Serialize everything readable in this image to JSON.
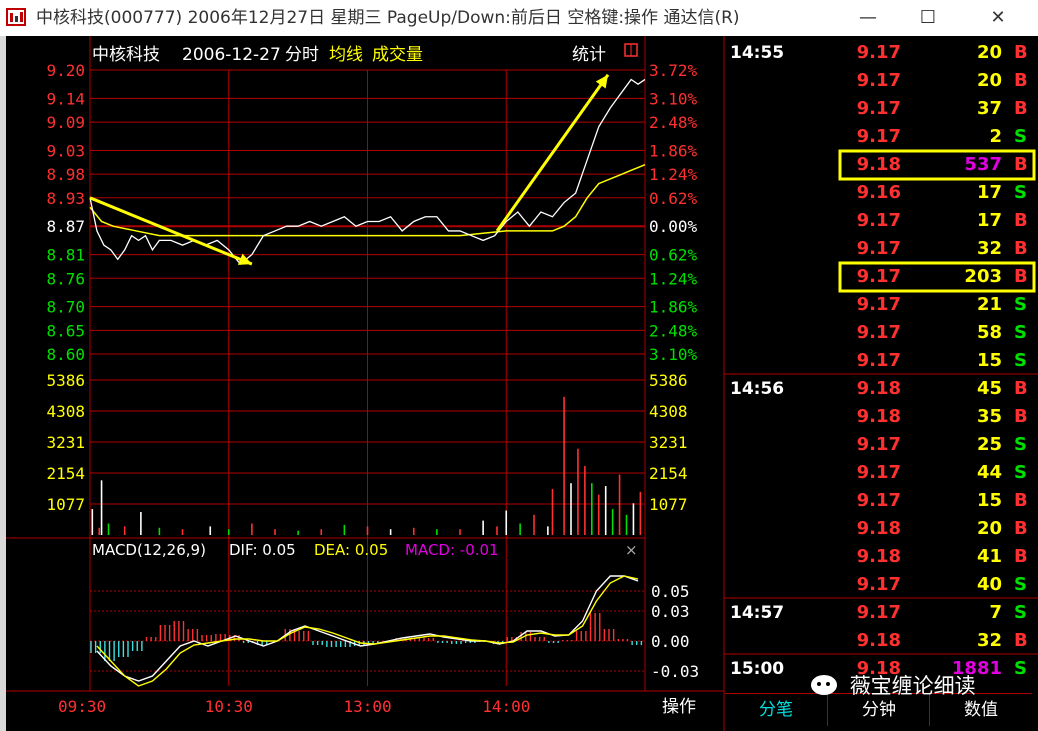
{
  "window": {
    "title": "中核科技(000777) 2006年12月27日 星期三 PageUp/Down:前后日 空格键:操作 通达信(R)",
    "controls": [
      "—",
      "☐",
      "✕"
    ]
  },
  "chart_header": {
    "stock_name": "中核科技",
    "date": "2006-12-27",
    "mode": "分时",
    "avg_label": "均线",
    "vol_label": "成交量",
    "stats_label": "统计"
  },
  "macd_header": {
    "name": "MACD(12,26,9)",
    "dif": "DIF: 0.05",
    "dea": "DEA: 0.05",
    "macd": "MACD: -0.01",
    "close": "×"
  },
  "bottom_bar": {
    "time_labels": [
      "09:30",
      "10:30",
      "13:00",
      "14:00"
    ],
    "operate": "操作"
  },
  "tabs": [
    "分笔",
    "分钟",
    "数值"
  ],
  "watermark": "薇宝缠论细读",
  "colors": {
    "up": "#ff3030",
    "down": "#00e000",
    "grid": "#b00000",
    "price_line": "#ffffff",
    "avg_line": "#ffff00",
    "macd_purple": "#e000e0"
  },
  "chart_data": [
    {
      "type": "line",
      "title": "中核科技 2006-12-27 分时",
      "y_ticks_left": [
        "9.20",
        "9.14",
        "9.09",
        "9.03",
        "8.98",
        "8.93",
        "8.87",
        "8.81",
        "8.76",
        "8.70",
        "8.65",
        "8.60"
      ],
      "y_ticks_right": [
        "3.72%",
        "3.10%",
        "2.48%",
        "1.86%",
        "1.24%",
        "0.62%",
        "0.00%",
        "0.62%",
        "1.24%",
        "1.86%",
        "2.48%",
        "3.10%"
      ],
      "x_ticks": [
        "09:30",
        "10:30",
        "13:00",
        "14:00"
      ],
      "ylim": [
        8.6,
        9.2
      ],
      "base_price": 8.87,
      "series": [
        {
          "name": "价格",
          "x": [
            0,
            3,
            6,
            9,
            12,
            15,
            18,
            21,
            24,
            27,
            30,
            35,
            40,
            45,
            50,
            55,
            60,
            65,
            70,
            75,
            80,
            85,
            90,
            95,
            100,
            105,
            110,
            115,
            120,
            125,
            130,
            135,
            140,
            145,
            150,
            155,
            160,
            165,
            170,
            175,
            180,
            185,
            190,
            195,
            200,
            205,
            210,
            215,
            220,
            225,
            228,
            231,
            234,
            237,
            240
          ],
          "y": [
            8.93,
            8.86,
            8.83,
            8.82,
            8.8,
            8.82,
            8.85,
            8.84,
            8.85,
            8.82,
            8.84,
            8.84,
            8.83,
            8.84,
            8.83,
            8.84,
            8.82,
            8.79,
            8.81,
            8.85,
            8.86,
            8.87,
            8.87,
            8.88,
            8.87,
            8.88,
            8.89,
            8.87,
            8.88,
            8.88,
            8.89,
            8.86,
            8.88,
            8.89,
            8.89,
            8.86,
            8.86,
            8.85,
            8.84,
            8.85,
            8.88,
            8.9,
            8.87,
            8.9,
            8.89,
            8.92,
            8.94,
            9.01,
            9.08,
            9.12,
            9.14,
            9.16,
            9.18,
            9.17,
            9.18
          ]
        },
        {
          "name": "均线",
          "x": [
            0,
            5,
            10,
            20,
            30,
            40,
            50,
            60,
            80,
            100,
            120,
            140,
            160,
            180,
            190,
            200,
            205,
            210,
            215,
            220,
            230,
            240
          ],
          "y": [
            8.91,
            8.88,
            8.87,
            8.86,
            8.85,
            8.85,
            8.85,
            8.85,
            8.85,
            8.85,
            8.85,
            8.85,
            8.85,
            8.86,
            8.86,
            8.86,
            8.87,
            8.89,
            8.93,
            8.96,
            8.98,
            9.0
          ]
        }
      ],
      "annotations": [
        {
          "type": "arrow",
          "from": [
            0,
            8.93
          ],
          "to": [
            70,
            8.79
          ]
        },
        {
          "type": "arrow",
          "from": [
            176,
            8.86
          ],
          "to": [
            224,
            9.19
          ]
        }
      ]
    },
    {
      "type": "bar",
      "title": "成交量",
      "y_ticks": [
        "5386",
        "4308",
        "3231",
        "2154",
        "1077"
      ],
      "ylim": [
        0,
        5386
      ],
      "x": [
        1,
        4,
        5,
        8,
        15,
        22,
        30,
        40,
        52,
        60,
        70,
        80,
        90,
        100,
        110,
        120,
        130,
        140,
        150,
        160,
        170,
        176,
        180,
        186,
        192,
        198,
        200,
        205,
        208,
        211,
        214,
        217,
        220,
        223,
        226,
        229,
        232,
        235,
        238
      ],
      "values": [
        900,
        250,
        1900,
        400,
        300,
        800,
        250,
        200,
        300,
        200,
        400,
        200,
        150,
        200,
        350,
        300,
        200,
        250,
        200,
        200,
        500,
        300,
        850,
        400,
        700,
        300,
        1600,
        4800,
        1800,
        3000,
        2400,
        1800,
        1400,
        1700,
        900,
        2100,
        700,
        1100,
        1500
      ],
      "colors": [
        "w",
        "r",
        "w",
        "g",
        "r",
        "w",
        "g",
        "r",
        "w",
        "g",
        "r",
        "r",
        "g",
        "r",
        "g",
        "r",
        "w",
        "r",
        "g",
        "r",
        "w",
        "r",
        "w",
        "g",
        "r",
        "w",
        "r",
        "r",
        "w",
        "r",
        "r",
        "g",
        "r",
        "w",
        "g",
        "r",
        "g",
        "w",
        "r"
      ]
    },
    {
      "type": "bar",
      "title": "MACD(12,26,9)",
      "y_ticks": [
        "0.05",
        "0.03",
        "0.00",
        "-0.03"
      ],
      "ylim": [
        -0.045,
        0.08
      ],
      "dif": [
        -0.01,
        -0.025,
        -0.035,
        -0.04,
        -0.035,
        -0.02,
        -0.005,
        0.0,
        -0.005,
        0.0,
        0.005,
        0.0,
        -0.005,
        0.0,
        0.01,
        0.015,
        0.01,
        0.005,
        0.0,
        -0.005,
        -0.003,
        0.0,
        0.003,
        0.005,
        0.007,
        0.004,
        0.002,
        0.0,
        0.0,
        -0.003,
        0.0,
        0.01,
        0.01,
        0.005,
        0.006,
        0.02,
        0.05,
        0.065,
        0.065,
        0.06
      ],
      "dea": [
        -0.005,
        -0.02,
        -0.035,
        -0.045,
        -0.04,
        -0.028,
        -0.012,
        -0.004,
        -0.002,
        0.0,
        0.002,
        0.002,
        0.0,
        0.0,
        0.008,
        0.014,
        0.012,
        0.008,
        0.003,
        -0.002,
        -0.003,
        -0.001,
        0.001,
        0.003,
        0.005,
        0.005,
        0.003,
        0.001,
        0.0,
        -0.002,
        -0.001,
        0.006,
        0.008,
        0.006,
        0.006,
        0.015,
        0.04,
        0.058,
        0.065,
        0.062
      ],
      "hist": [
        -0.012,
        -0.02,
        -0.016,
        -0.01,
        0.004,
        0.016,
        0.02,
        0.012,
        0.006,
        0.007,
        0.006,
        -0.002,
        -0.004,
        0.0,
        0.012,
        0.01,
        -0.004,
        -0.006,
        -0.006,
        -0.005,
        -0.003,
        0.0,
        0.003,
        0.003,
        0.003,
        -0.002,
        -0.003,
        -0.002,
        -0.001,
        -0.003,
        0.004,
        0.009,
        0.004,
        -0.002,
        0.001,
        0.01,
        0.028,
        0.012,
        0.002,
        -0.004
      ]
    }
  ],
  "ticks": {
    "groups": [
      {
        "time": "14:55",
        "rows": [
          {
            "price": "9.17",
            "vol": "20",
            "bs": "B"
          },
          {
            "price": "9.17",
            "vol": "20",
            "bs": "B"
          },
          {
            "price": "9.17",
            "vol": "37",
            "bs": "B"
          },
          {
            "price": "9.17",
            "vol": "2",
            "bs": "S"
          },
          {
            "price": "9.18",
            "vol": "537",
            "bs": "B",
            "highlight": true,
            "purple": true
          },
          {
            "price": "9.16",
            "vol": "17",
            "bs": "S"
          },
          {
            "price": "9.17",
            "vol": "17",
            "bs": "B"
          },
          {
            "price": "9.17",
            "vol": "32",
            "bs": "B"
          },
          {
            "price": "9.17",
            "vol": "203",
            "bs": "B",
            "highlight": true
          },
          {
            "price": "9.17",
            "vol": "21",
            "bs": "S"
          },
          {
            "price": "9.17",
            "vol": "58",
            "bs": "S"
          },
          {
            "price": "9.17",
            "vol": "15",
            "bs": "S"
          }
        ]
      },
      {
        "time": "14:56",
        "rows": [
          {
            "price": "9.18",
            "vol": "45",
            "bs": "B"
          },
          {
            "price": "9.18",
            "vol": "35",
            "bs": "B"
          },
          {
            "price": "9.17",
            "vol": "25",
            "bs": "S"
          },
          {
            "price": "9.17",
            "vol": "44",
            "bs": "S"
          },
          {
            "price": "9.17",
            "vol": "15",
            "bs": "B"
          },
          {
            "price": "9.18",
            "vol": "20",
            "bs": "B"
          },
          {
            "price": "9.18",
            "vol": "41",
            "bs": "B"
          },
          {
            "price": "9.17",
            "vol": "40",
            "bs": "S"
          }
        ]
      },
      {
        "time": "14:57",
        "rows": [
          {
            "price": "9.17",
            "vol": "7",
            "bs": "S"
          },
          {
            "price": "9.18",
            "vol": "32",
            "bs": "B"
          }
        ]
      },
      {
        "time": "15:00",
        "rows": [
          {
            "price": "9.18",
            "vol": "1881",
            "bs": "S",
            "purple": true
          }
        ]
      }
    ]
  }
}
